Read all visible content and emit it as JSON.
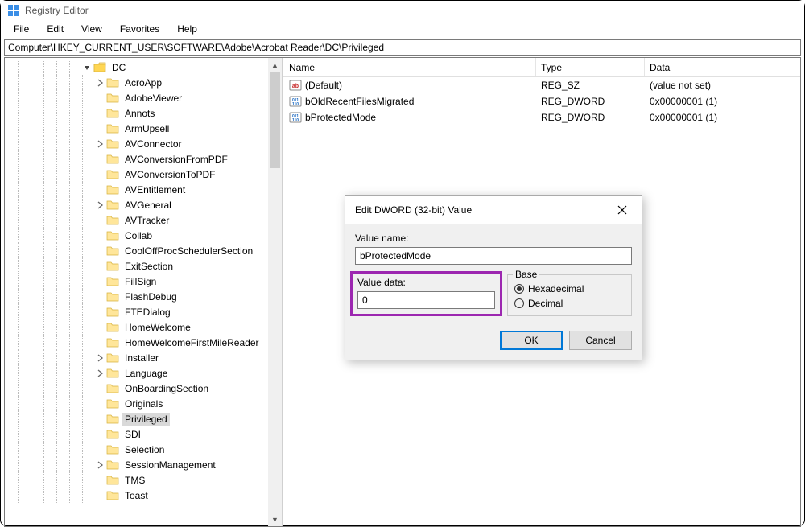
{
  "app": {
    "title": "Registry Editor"
  },
  "menu": {
    "items": [
      "File",
      "Edit",
      "View",
      "Favorites",
      "Help"
    ]
  },
  "address": {
    "path": "Computer\\HKEY_CURRENT_USER\\SOFTWARE\\Adobe\\Acrobat Reader\\DC\\Privileged"
  },
  "tree": {
    "root_label": "DC",
    "items": [
      {
        "label": "AcroApp",
        "expand": true
      },
      {
        "label": "AdobeViewer",
        "expand": false
      },
      {
        "label": "Annots",
        "expand": false
      },
      {
        "label": "ArmUpsell",
        "expand": false
      },
      {
        "label": "AVConnector",
        "expand": true
      },
      {
        "label": "AVConversionFromPDF",
        "expand": false
      },
      {
        "label": "AVConversionToPDF",
        "expand": false
      },
      {
        "label": "AVEntitlement",
        "expand": false
      },
      {
        "label": "AVGeneral",
        "expand": true
      },
      {
        "label": "AVTracker",
        "expand": false
      },
      {
        "label": "Collab",
        "expand": false
      },
      {
        "label": "CoolOffProcSchedulerSection",
        "expand": false
      },
      {
        "label": "ExitSection",
        "expand": false
      },
      {
        "label": "FillSign",
        "expand": false
      },
      {
        "label": "FlashDebug",
        "expand": false
      },
      {
        "label": "FTEDialog",
        "expand": false
      },
      {
        "label": "HomeWelcome",
        "expand": false
      },
      {
        "label": "HomeWelcomeFirstMileReader",
        "expand": false
      },
      {
        "label": "Installer",
        "expand": true
      },
      {
        "label": "Language",
        "expand": true
      },
      {
        "label": "OnBoardingSection",
        "expand": false
      },
      {
        "label": "Originals",
        "expand": false
      },
      {
        "label": "Privileged",
        "expand": false,
        "selected": true
      },
      {
        "label": "SDI",
        "expand": false
      },
      {
        "label": "Selection",
        "expand": false
      },
      {
        "label": "SessionManagement",
        "expand": true
      },
      {
        "label": "TMS",
        "expand": false
      },
      {
        "label": "Toast",
        "expand": false
      }
    ]
  },
  "list": {
    "headers": {
      "name": "Name",
      "type": "Type",
      "data": "Data"
    },
    "rows": [
      {
        "icon": "string",
        "name": "(Default)",
        "type": "REG_SZ",
        "data": "(value not set)"
      },
      {
        "icon": "binary",
        "name": "bOldRecentFilesMigrated",
        "type": "REG_DWORD",
        "data": "0x00000001 (1)"
      },
      {
        "icon": "binary",
        "name": "bProtectedMode",
        "type": "REG_DWORD",
        "data": "0x00000001 (1)"
      }
    ]
  },
  "dialog": {
    "title": "Edit DWORD (32-bit) Value",
    "value_name_label": "Value name:",
    "value_name": "bProtectedMode",
    "value_data_label": "Value data:",
    "value_data": "0",
    "base_label": "Base",
    "hex_label": "Hexadecimal",
    "dec_label": "Decimal",
    "ok_label": "OK",
    "cancel_label": "Cancel"
  }
}
